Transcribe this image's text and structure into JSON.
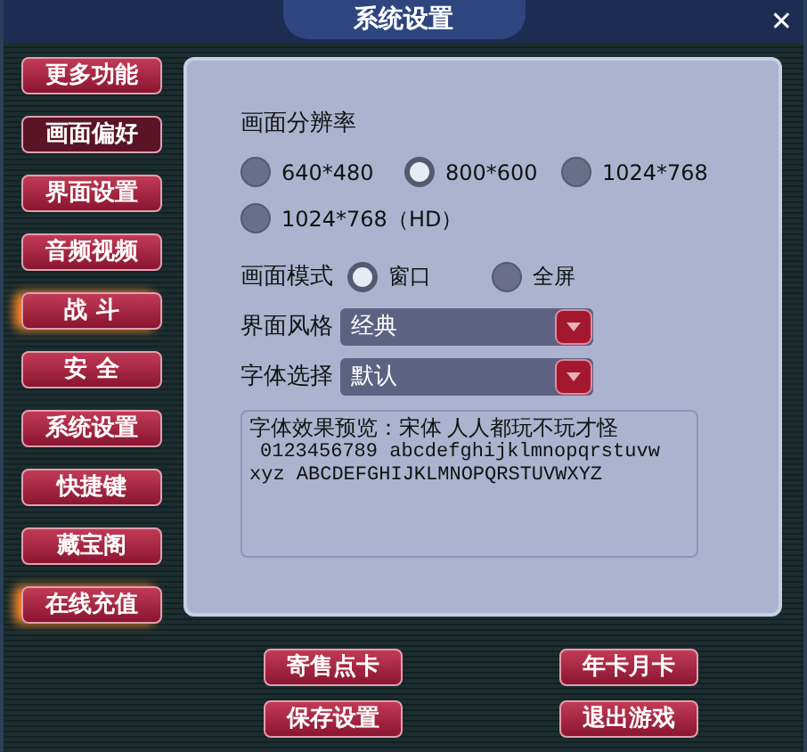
{
  "window": {
    "title": "系统设置",
    "close": "✕"
  },
  "sidebar": {
    "items": [
      {
        "label": "更多功能",
        "selected": false,
        "glow": false
      },
      {
        "label": "画面偏好",
        "selected": true,
        "glow": false
      },
      {
        "label": "界面设置",
        "selected": false,
        "glow": false
      },
      {
        "label": "音频视频",
        "selected": false,
        "glow": false
      },
      {
        "label": "战 斗",
        "selected": false,
        "glow": true
      },
      {
        "label": "安 全",
        "selected": false,
        "glow": false
      },
      {
        "label": "系统设置",
        "selected": false,
        "glow": false
      },
      {
        "label": "快捷键",
        "selected": false,
        "glow": false
      },
      {
        "label": "藏宝阁",
        "selected": false,
        "glow": false
      },
      {
        "label": "在线充值",
        "selected": false,
        "glow": true
      }
    ]
  },
  "resolution": {
    "label": "画面分辨率",
    "options": [
      {
        "label": "640*480",
        "selected": false
      },
      {
        "label": "800*600",
        "selected": true
      },
      {
        "label": "1024*768",
        "selected": false
      },
      {
        "label": "1024*768（HD）",
        "selected": false
      }
    ]
  },
  "mode": {
    "label": "画面模式",
    "options": [
      {
        "label": "窗口",
        "selected": true
      },
      {
        "label": "全屏",
        "selected": false
      }
    ]
  },
  "dropdowns": [
    {
      "label": "界面风格",
      "value": "经典"
    },
    {
      "label": "字体选择",
      "value": "默认"
    }
  ],
  "preview": {
    "lines": [
      "字体效果预览：宋体 人人都玩不玩才怪",
      "0123456789 abcdefghijklmnopqrstuvw",
      "xyz ABCDEFGHIJKLMNOPQRSTUVWXYZ"
    ]
  },
  "buttons": [
    "寄售点卡",
    "年卡月卡",
    "保存设置",
    "退出游戏"
  ]
}
